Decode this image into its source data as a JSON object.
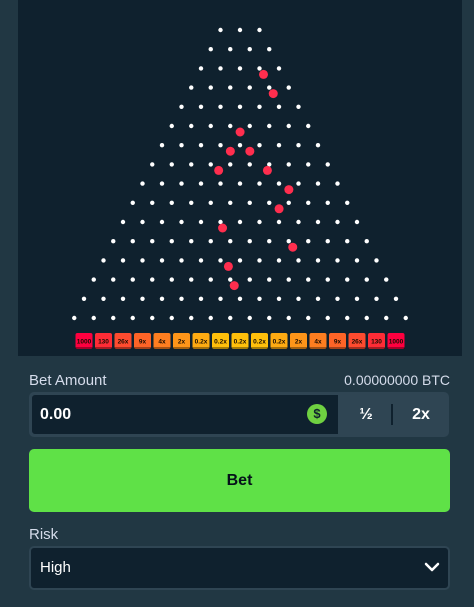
{
  "board": {
    "rows": 16,
    "multipliers": [
      "1000",
      "130",
      "26x",
      "9x",
      "4x",
      "2x",
      "0.2x",
      "0.2x",
      "0.2x",
      "0.2x",
      "0.2x",
      "2x",
      "4x",
      "9x",
      "26x",
      "130",
      "1000"
    ],
    "bucket_colors": [
      "#ff003f",
      "#fe2c36",
      "#fe4b2f",
      "#fe6427",
      "#fe7e20",
      "#fe9519",
      "#feab12",
      "#ffc00b",
      "#ffc00b",
      "#ffc00b",
      "#feab12",
      "#fe9519",
      "#fe7e20",
      "#fe6427",
      "#fe4b2f",
      "#fe2c36",
      "#ff003f"
    ],
    "ball_color": "#ff2e4e",
    "peg_color": "#ffffff"
  },
  "bet_amount": {
    "label": "Bet Amount",
    "balance": "0.00000000 BTC",
    "value": "0.00",
    "coin_icon": "$",
    "half_label": "½",
    "double_label": "2x"
  },
  "bet_button": {
    "label": "Bet"
  },
  "risk": {
    "label": "Risk",
    "value": "High"
  },
  "colors": {
    "bet_green": "#5fe147",
    "panel": "#213743",
    "board_bg": "#0f212e"
  }
}
